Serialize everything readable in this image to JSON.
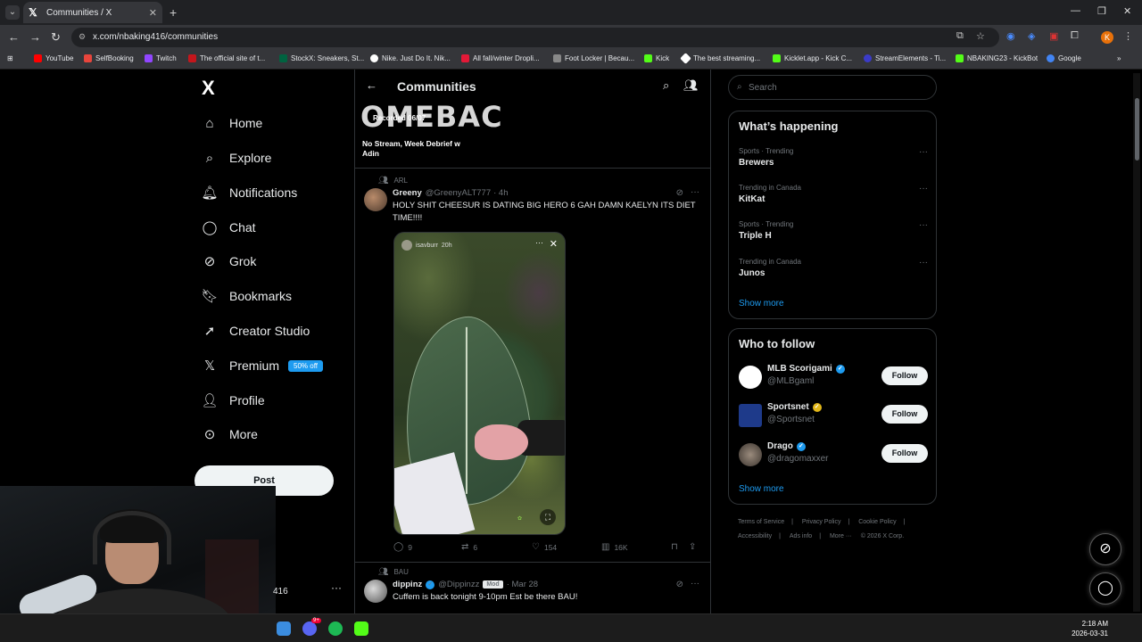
{
  "browser": {
    "tab_title": "Communities / X",
    "url": "x.com/nbaking416/communities",
    "profile_initial": "K",
    "bookmarks": [
      {
        "label": "YouTube",
        "color": "#ff0000"
      },
      {
        "label": "SelfBooking",
        "color": "#e8453c"
      },
      {
        "label": "Twitch",
        "color": "#9146ff"
      },
      {
        "label": "The official site of t...",
        "color": "#c4161c"
      },
      {
        "label": "StockX: Sneakers, St...",
        "color": "#006340"
      },
      {
        "label": "Nike. Just Do It. Nik...",
        "color": "#ffffff"
      },
      {
        "label": "All fall/winter Dropli...",
        "color": "#e31937"
      },
      {
        "label": "Foot Locker | Becau...",
        "color": "#888888"
      },
      {
        "label": "Kick",
        "color": "#53fc18"
      },
      {
        "label": "The best streaming...",
        "color": "#ffffff"
      },
      {
        "label": "Kicklet.app - Kick C...",
        "color": "#53fc18"
      },
      {
        "label": "StreamElements - Ti...",
        "color": "#3b3bc8"
      },
      {
        "label": "NBAKING23 - KickBot",
        "color": "#53fc18"
      },
      {
        "label": "Google",
        "color": "#4285f4"
      }
    ]
  },
  "nav": {
    "logo": "X",
    "items": [
      {
        "label": "Home"
      },
      {
        "label": "Explore"
      },
      {
        "label": "Notifications"
      },
      {
        "label": "Chat"
      },
      {
        "label": "Grok"
      },
      {
        "label": "Bookmarks"
      },
      {
        "label": "Creator Studio"
      },
      {
        "label": "Premium",
        "badge": "50% off"
      },
      {
        "label": "Profile"
      },
      {
        "label": "More"
      }
    ],
    "post_label": "Post",
    "account_handle_fragment": "416"
  },
  "feed": {
    "title": "Communities",
    "banner": {
      "logo_text": "OMEBAC",
      "recorded": "Recorded 06/07",
      "caption": "No Stream, Week Debrief w Adin"
    },
    "posts": [
      {
        "community": "ARL",
        "name": "Greeny",
        "handle": "@GreenyALT777",
        "time": "· 4h",
        "text": "HOLY SHIT CHEESUR IS DATING BIG HERO 6 GAH DAMN KAELYN ITS DIET TIME!!!!",
        "media_user": "isavburr",
        "media_time": "20h",
        "stats": {
          "replies": "9",
          "reposts": "6",
          "likes": "154",
          "views": "16K"
        }
      },
      {
        "community": "BAU",
        "name": "dippinz",
        "handle": "@Dippinzz",
        "mod_badge": "Mod",
        "time": "· Mar 28",
        "text": "Cuffem is back tonight 9-10pm Est be there BAU!"
      }
    ]
  },
  "sidebar": {
    "search_placeholder": "Search",
    "happening_title": "What’s happening",
    "trends": [
      {
        "context": "Sports · Trending",
        "name": "Brewers"
      },
      {
        "context": "Trending in Canada",
        "name": "KitKat"
      },
      {
        "context": "Sports · Trending",
        "name": "Triple H"
      },
      {
        "context": "Trending in Canada",
        "name": "Junos"
      }
    ],
    "show_more": "Show more",
    "who_title": "Who to follow",
    "follow": [
      {
        "name": "MLB Scorigami",
        "handle": "@MLBgaml",
        "badge": "blue"
      },
      {
        "name": "Sportsnet",
        "handle": "@Sportsnet",
        "badge": "gold"
      },
      {
        "name": "Drago",
        "handle": "@dragomaxxer",
        "badge": "blue"
      }
    ],
    "follow_label": "Follow",
    "footer": [
      "Terms of Service",
      "Privacy Policy",
      "Cookie Policy",
      "Accessibility",
      "Ads info",
      "More ···",
      "© 2026 X Corp."
    ]
  },
  "system": {
    "time": "2:18 AM",
    "date": "2026-03-31",
    "discord_badge": "9+"
  }
}
